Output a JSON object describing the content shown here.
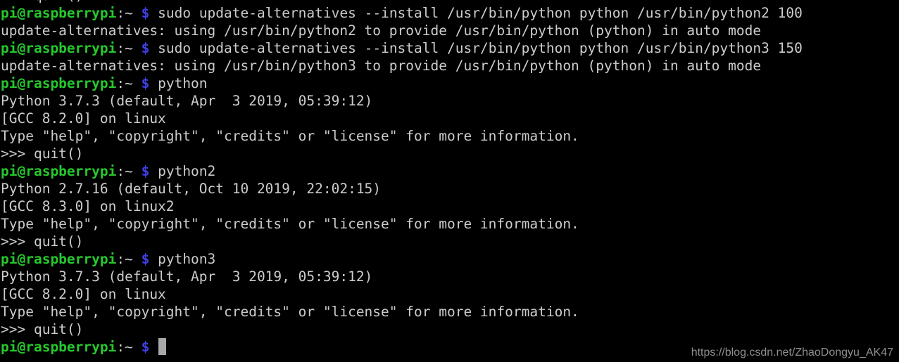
{
  "terminal": {
    "background_color": "#000000",
    "foreground_color": "#cccccc",
    "prompt_user_color": "#26c82d",
    "prompt_symbol_color": "#4040e8",
    "cursor_color": "#a8a8a8",
    "prompt": {
      "userhost": "pi@raspberrypi",
      "path": ":~",
      "symbol": "$"
    },
    "clipped_top_line": ">>> quit()",
    "lines": [
      {
        "type": "prompt",
        "command": "sudo update-alternatives --install /usr/bin/python python /usr/bin/python2 100"
      },
      {
        "type": "output",
        "text": "update-alternatives: using /usr/bin/python2 to provide /usr/bin/python (python) in auto mode"
      },
      {
        "type": "prompt",
        "command": "sudo update-alternatives --install /usr/bin/python python /usr/bin/python3 150"
      },
      {
        "type": "output",
        "text": "update-alternatives: using /usr/bin/python3 to provide /usr/bin/python (python) in auto mode"
      },
      {
        "type": "prompt",
        "command": "python"
      },
      {
        "type": "output",
        "text": "Python 3.7.3 (default, Apr  3 2019, 05:39:12)"
      },
      {
        "type": "output",
        "text": "[GCC 8.2.0] on linux"
      },
      {
        "type": "output",
        "text": "Type \"help\", \"copyright\", \"credits\" or \"license\" for more information."
      },
      {
        "type": "output",
        "text": ">>> quit()"
      },
      {
        "type": "prompt",
        "command": "python2"
      },
      {
        "type": "output",
        "text": "Python 2.7.16 (default, Oct 10 2019, 22:02:15)"
      },
      {
        "type": "output",
        "text": "[GCC 8.3.0] on linux2"
      },
      {
        "type": "output",
        "text": "Type \"help\", \"copyright\", \"credits\" or \"license\" for more information."
      },
      {
        "type": "output",
        "text": ">>> quit()"
      },
      {
        "type": "prompt",
        "command": "python3"
      },
      {
        "type": "output",
        "text": "Python 3.7.3 (default, Apr  3 2019, 05:39:12)"
      },
      {
        "type": "output",
        "text": "[GCC 8.2.0] on linux"
      },
      {
        "type": "output",
        "text": "Type \"help\", \"copyright\", \"credits\" or \"license\" for more information."
      },
      {
        "type": "output",
        "text": ">>> quit()"
      },
      {
        "type": "prompt",
        "command": "",
        "cursor": true
      }
    ]
  },
  "watermark": {
    "text": "https://blog.csdn.net/ZhaoDongyu_AK47"
  }
}
